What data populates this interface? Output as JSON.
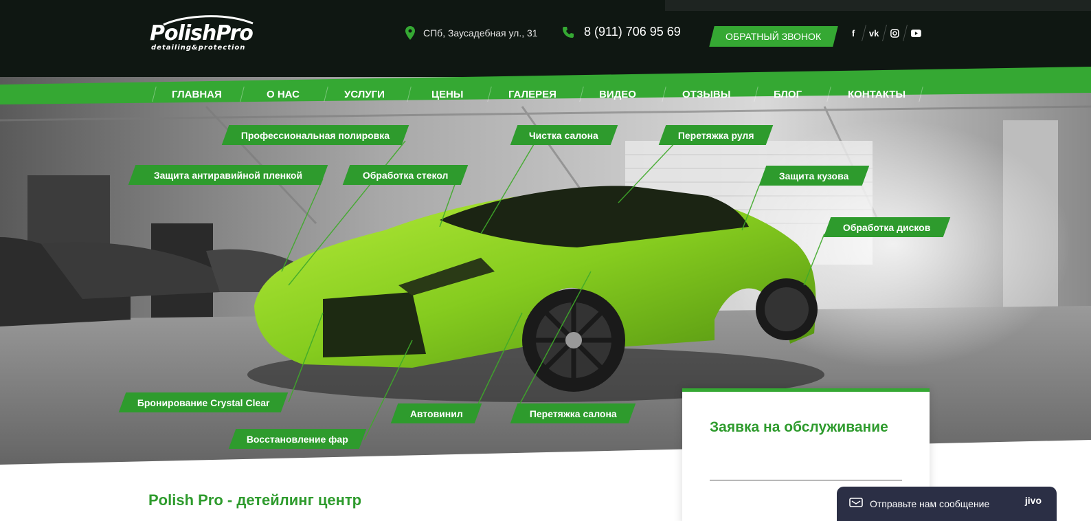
{
  "header": {
    "logo_title": "PolishPro",
    "logo_subtitle": "detailing&protection",
    "address": "СПб, Заусадебная ул., 31",
    "phone": "8 (911) 706 95 69",
    "callback_label": "ОБРАТНЫЙ ЗВОНОК",
    "socials": [
      {
        "name": "facebook-icon",
        "glyph": "f"
      },
      {
        "name": "vk-icon",
        "glyph": "vk"
      },
      {
        "name": "instagram-icon",
        "glyph": ""
      },
      {
        "name": "youtube-icon",
        "glyph": ""
      }
    ]
  },
  "nav": {
    "items": [
      "ГЛАВНАЯ",
      "О НАС",
      "УСЛУГИ",
      "ЦЕНЫ",
      "ГАЛЕРЕЯ",
      "ВИДЕО",
      "ОТЗЫВЫ",
      "БЛОГ",
      "КОНТАКТЫ"
    ]
  },
  "services": [
    "Профессиональная полировка",
    "Чистка салона",
    "Перетяжка руля",
    "Защита антиравийной пленкой",
    "Обработка стекол",
    "Защита кузова",
    "Обработка дисков",
    "Бронирование Crystal Clear",
    "Автовинил",
    "Перетяжка салона",
    "Восстановление фар"
  ],
  "form": {
    "title": "Заявка на обслуживание"
  },
  "page": {
    "heading": "Polish Pro - детейлинг центр"
  },
  "chat": {
    "label": "Отправьте нам сообщение",
    "brand": "jivo"
  },
  "colors": {
    "accent": "#35a833",
    "header_bg": "#0f1712",
    "car_green": "#8fd12a"
  }
}
